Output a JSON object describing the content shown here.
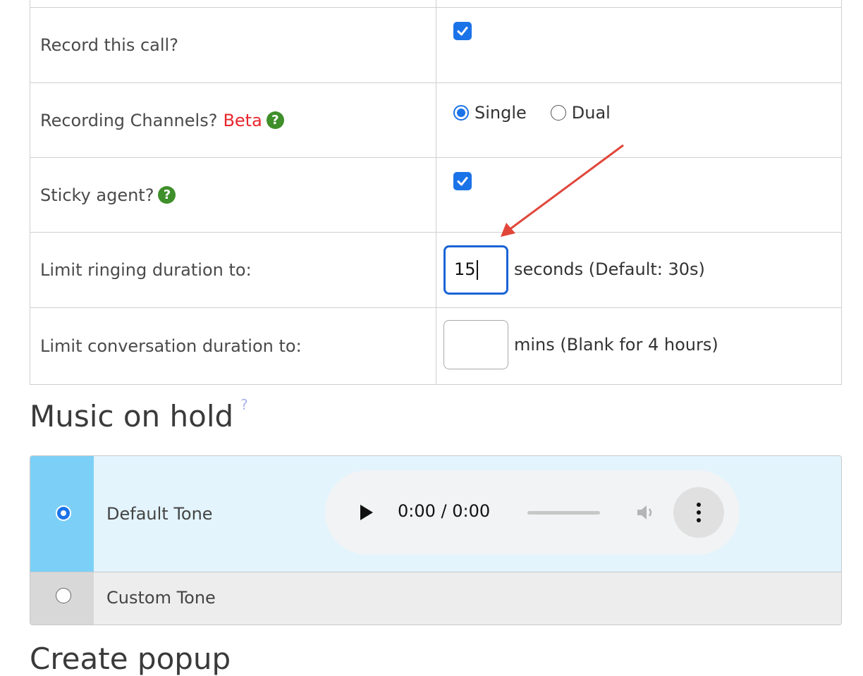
{
  "settings": {
    "record_call": {
      "label": "Record this call?",
      "checked": true
    },
    "recording_channels": {
      "label": "Recording Channels?",
      "badge": "Beta",
      "options": [
        {
          "label": "Single",
          "selected": true
        },
        {
          "label": "Dual",
          "selected": false
        }
      ]
    },
    "sticky_agent": {
      "label": "Sticky agent?",
      "checked": true
    },
    "ringing_duration": {
      "label": "Limit ringing duration to:",
      "value": "15",
      "suffix": "seconds (Default: 30s)"
    },
    "conversation_duration": {
      "label": "Limit conversation duration to:",
      "value": "",
      "suffix": "mins (Blank for 4 hours)"
    }
  },
  "help_icon_glyph": "?",
  "music_on_hold": {
    "title": "Music on hold",
    "help_glyph": "?",
    "options": [
      {
        "label": "Default Tone",
        "selected": true
      },
      {
        "label": "Custom Tone",
        "selected": false
      }
    ],
    "player": {
      "time": "0:00 / 0:00",
      "progress": 0
    }
  },
  "next_section": {
    "title": "Create popup"
  },
  "colors": {
    "accent": "#1b73e8",
    "beta": "#e8262e",
    "help": "#3f8f2a",
    "selected_row": "#e3f4fd",
    "annotation_arrow": "#e0473a"
  }
}
